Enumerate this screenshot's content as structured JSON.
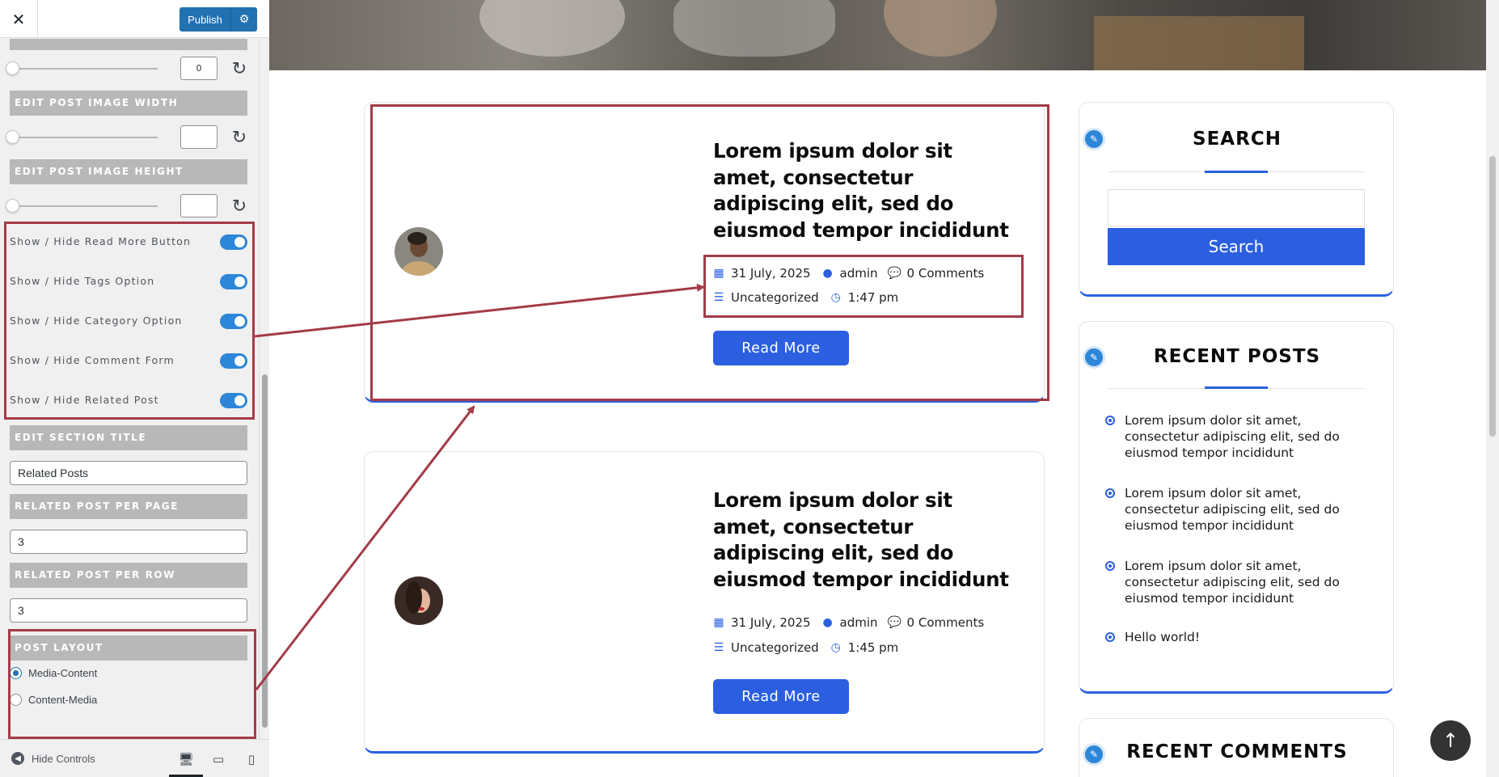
{
  "customizer": {
    "close_label": "✕",
    "publish_label": "Publish",
    "sections": {
      "image_width": "EDIT POST IMAGE WIDTH",
      "image_height": "EDIT POST IMAGE HEIGHT",
      "section_title": "EDIT SECTION TITLE",
      "per_page": "RELATED POST PER PAGE",
      "per_row": "RELATED POST PER ROW",
      "post_layout": "POST LAYOUT"
    },
    "border_radius_value": "0",
    "image_width_value": "",
    "image_height_value": "",
    "toggles": [
      {
        "label": "Show / Hide Read More Button",
        "on": true
      },
      {
        "label": "Show / Hide Tags Option",
        "on": true
      },
      {
        "label": "Show / Hide Category Option",
        "on": true
      },
      {
        "label": "Show / Hide Comment Form",
        "on": true
      },
      {
        "label": "Show / Hide Related Post",
        "on": true
      }
    ],
    "section_title_value": "Related Posts",
    "per_page_value": "3",
    "per_row_value": "3",
    "layout_options": [
      {
        "label": "Media-Content",
        "checked": true
      },
      {
        "label": "Content-Media",
        "checked": false
      }
    ],
    "hide_controls_label": "Hide Controls"
  },
  "posts": [
    {
      "title": "Lorem ipsum dolor sit amet, consectetur adipiscing elit, sed do eiusmod tempor incididunt",
      "date": "31 July, 2025",
      "author": "admin",
      "comments": "0 Comments",
      "category": "Uncategorized",
      "time": "1:47 pm",
      "read_more": "Read More"
    },
    {
      "title": "Lorem ipsum dolor sit amet, consectetur adipiscing elit, sed do eiusmod tempor incididunt",
      "date": "31 July, 2025",
      "author": "admin",
      "comments": "0 Comments",
      "category": "Uncategorized",
      "time": "1:45 pm",
      "read_more": "Read More"
    }
  ],
  "sidebar": {
    "search_title": "SEARCH",
    "search_button": "Search",
    "recent_posts_title": "RECENT POSTS",
    "recent_posts": [
      "Lorem ipsum dolor sit amet, consectetur adipiscing elit, sed do eiusmod tempor incididunt",
      "Lorem ipsum dolor sit amet, consectetur adipiscing elit, sed do eiusmod tempor incididunt",
      "Lorem ipsum dolor sit amet, consectetur adipiscing elit, sed do eiusmod tempor incididunt",
      "Hello world!"
    ],
    "recent_comments_title": "RECENT COMMENTS"
  },
  "colors": {
    "accent": "#2b5fe0",
    "toggle_on": "#2e86d8",
    "highlight": "#a33b48",
    "publish": "#2271b1"
  }
}
